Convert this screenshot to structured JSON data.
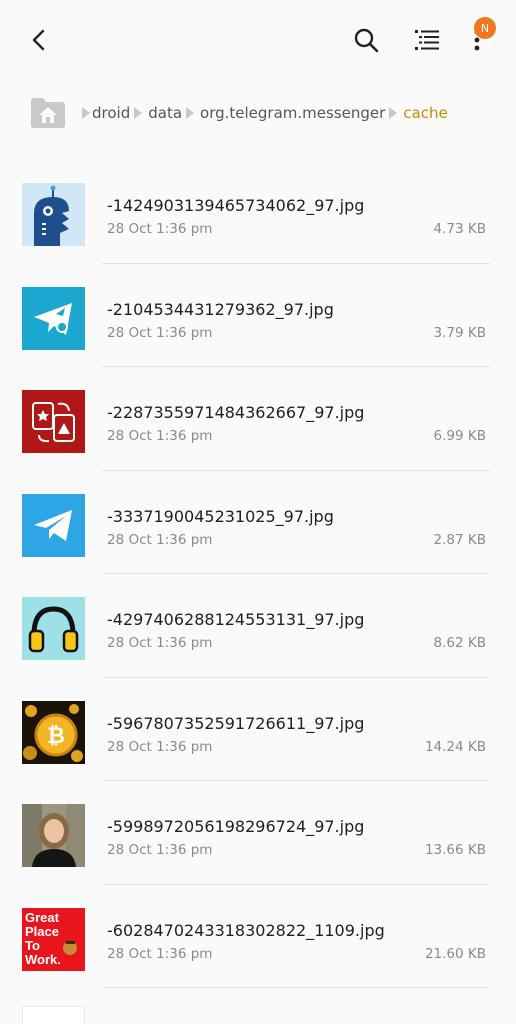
{
  "toolbar": {
    "back": "back-arrow-icon",
    "search": "search-icon",
    "sort": "sort-list-icon",
    "more": "more-vert-icon",
    "notification_badge": "N",
    "badge_color": "#f2761f"
  },
  "breadcrumb": {
    "home": "home-folder-icon",
    "items": [
      "droid",
      "data",
      "org.telegram.messenger",
      "cache"
    ],
    "current_color": "#c88a00"
  },
  "files": [
    {
      "name": "-1424903139465734062_97.jpg",
      "date": "28 Oct 1:36 pm",
      "size": "4.73 KB",
      "thumb": "blue-bot-logo"
    },
    {
      "name": "-2104534431279362_97.jpg",
      "date": "28 Oct 1:36 pm",
      "size": "3.79 KB",
      "thumb": "telegram-tools-logo"
    },
    {
      "name": "-2287355971484362667_97.jpg",
      "date": "28 Oct 1:36 pm",
      "size": "6.99 KB",
      "thumb": "red-exchange-logo"
    },
    {
      "name": "-3337190045231025_97.jpg",
      "date": "28 Oct 1:36 pm",
      "size": "2.87 KB",
      "thumb": "telegram-logo"
    },
    {
      "name": "-4297406288124553131_97.jpg",
      "date": "28 Oct 1:36 pm",
      "size": "8.62 KB",
      "thumb": "headphones-logo"
    },
    {
      "name": "-5967807352591726611_97.jpg",
      "date": "28 Oct 1:36 pm",
      "size": "14.24 KB",
      "thumb": "bitcoin-coins"
    },
    {
      "name": "-5998972056198296724_97.jpg",
      "date": "28 Oct 1:36 pm",
      "size": "13.66 KB",
      "thumb": "woman-portrait"
    },
    {
      "name": "-6028470243318302822_1109.jpg",
      "date": "28 Oct 1:36 pm",
      "size": "21.60 KB",
      "thumb": "great-place-to-work-logo",
      "thumb_text": [
        "Great",
        "Place",
        "To",
        "Work."
      ]
    }
  ]
}
